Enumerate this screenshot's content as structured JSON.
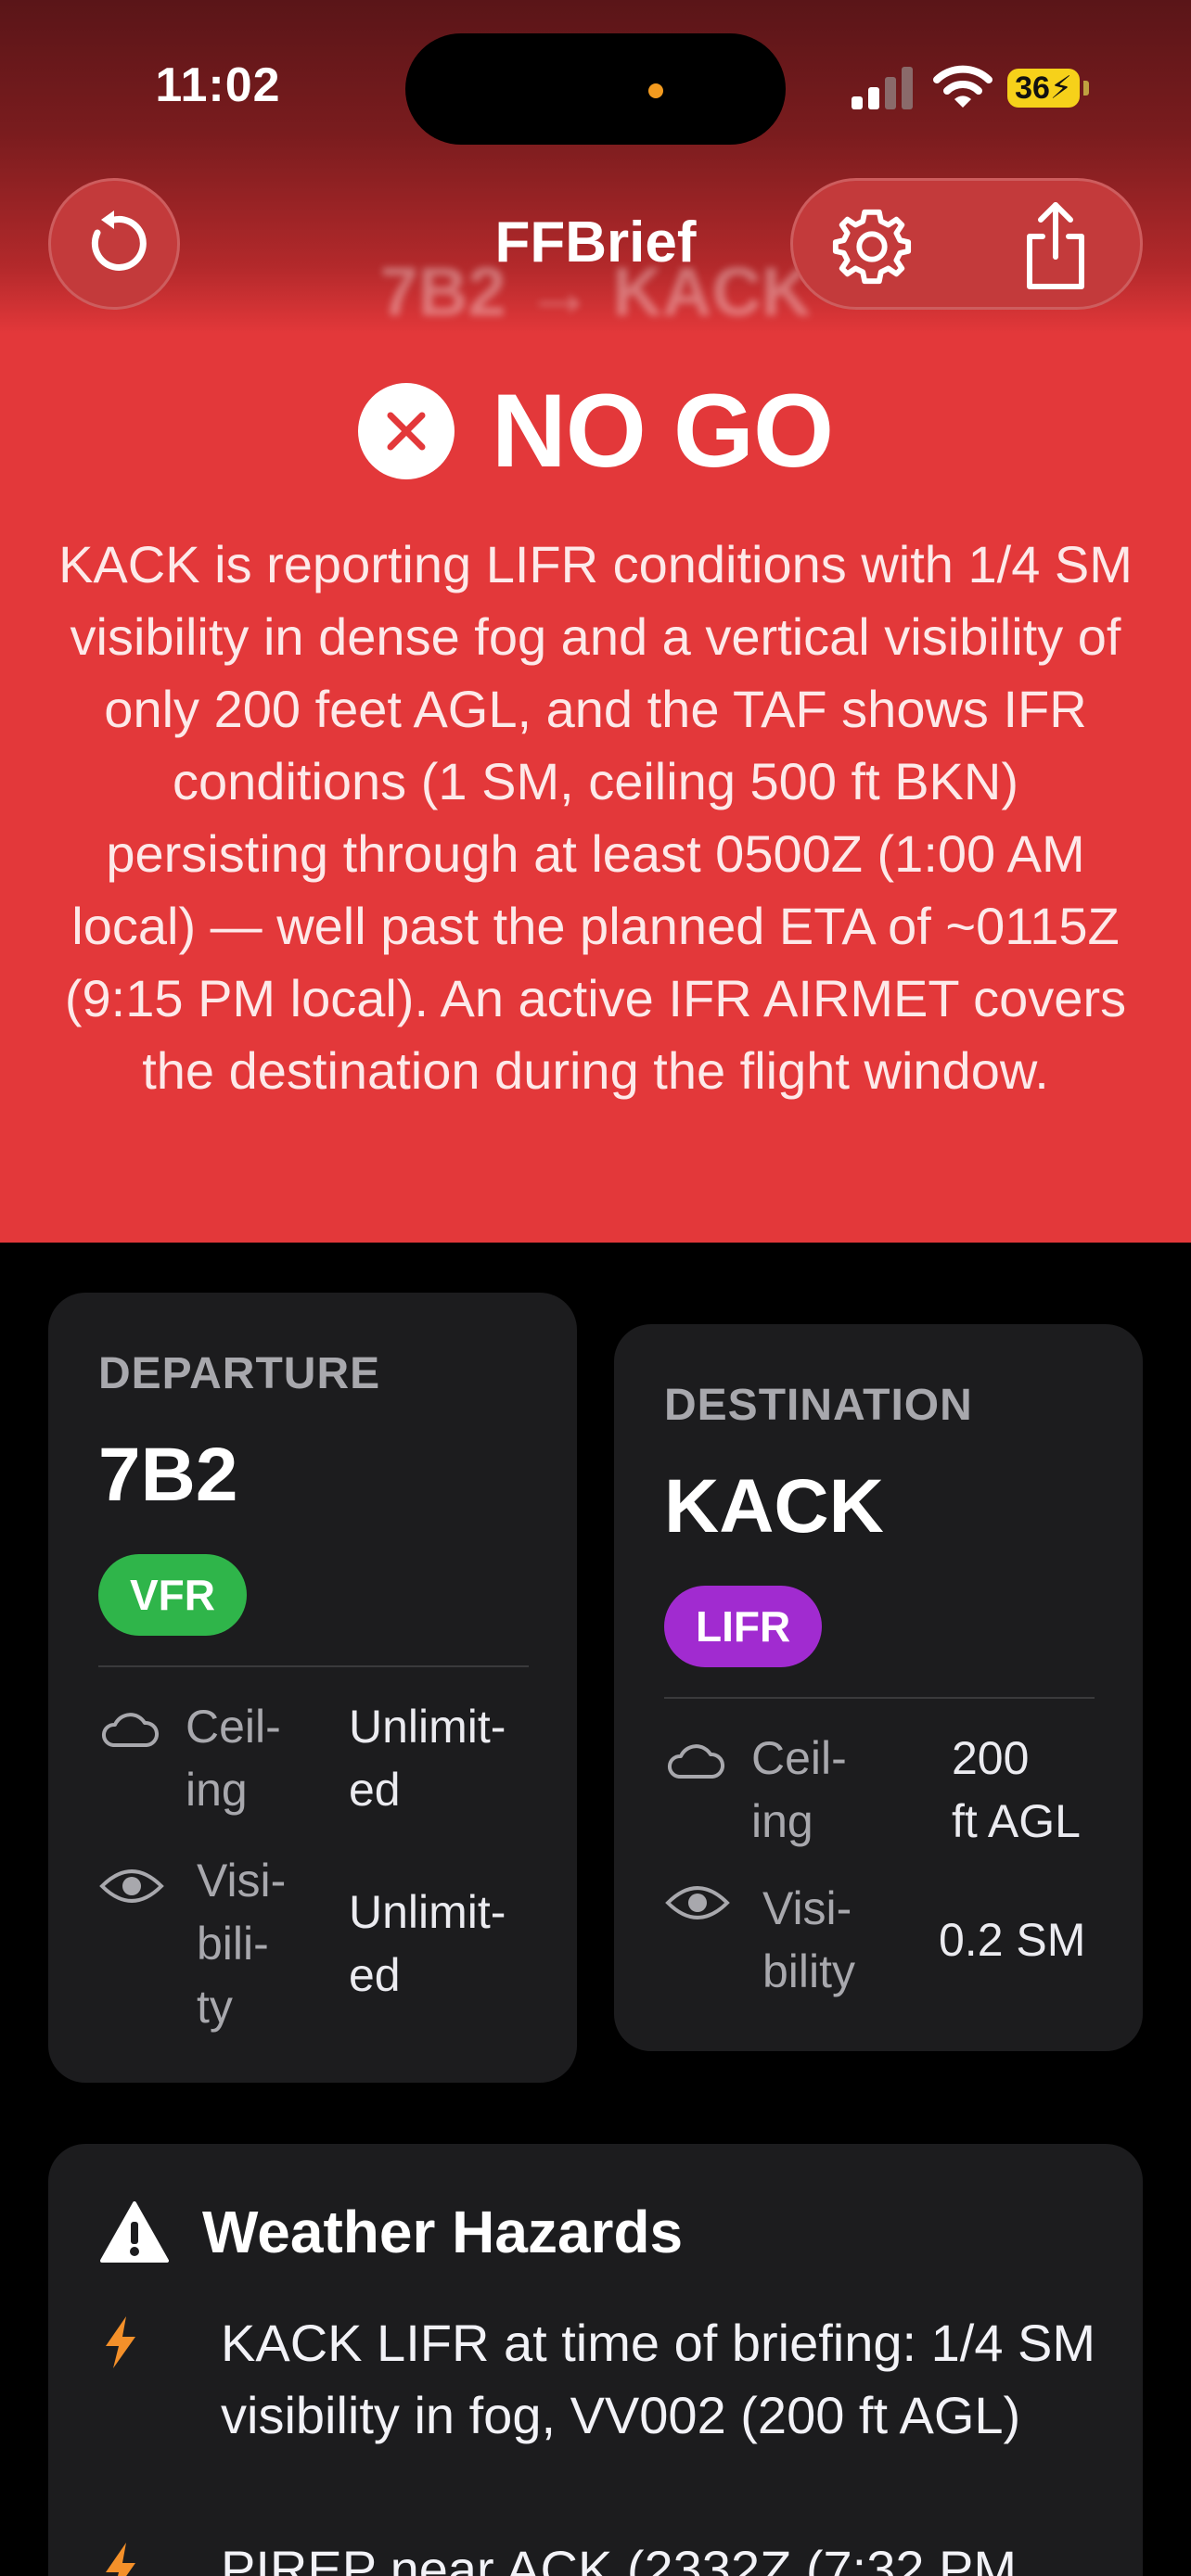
{
  "status_bar": {
    "time": "11:02",
    "battery": "36"
  },
  "nav": {
    "title": "FFBrief",
    "route": "7B2 → KACK",
    "icons": {
      "back": "rotate-ccw-icon",
      "settings": "gear-icon",
      "share": "share-icon"
    }
  },
  "verdict": {
    "label": "NO GO",
    "icon": "x-circle-icon",
    "summary": "KACK is reporting LIFR conditions with 1/4 SM visibility in dense fog and a vertical visibility of only 200 feet AGL, and the TAF shows IFR conditions (1 SM, ceiling 500 ft BKN) persisting through at least 0500Z (1:00 AM local) — well past the planned ETA of ~0115Z (9:15 PM local). An active IFR AIRMET covers the destination during the flight window.",
    "color": "#e3383a"
  },
  "departure": {
    "label": "DEPARTURE",
    "code": "7B2",
    "category": "VFR",
    "category_color": "#2fb54a",
    "ceiling_label": "Ceil-\ning",
    "ceiling_value": "Unlimit-\ned",
    "visibility_label": "Visi-\nbili-\nty",
    "visibility_value": "Unlimit-\ned"
  },
  "destination": {
    "label": "DESTINATION",
    "code": "KACK",
    "category": "LIFR",
    "category_color": "#a12bd0",
    "ceiling_label": "Ceil-\ning",
    "ceiling_value": "200\nft AGL",
    "visibility_label": "Visi-\nbility",
    "visibility_value": "0.2 SM"
  },
  "hazards": {
    "title": "Weather Hazards",
    "items": [
      "KACK LIFR at time of briefing: 1/4 SM visibility in fog, VV002 (200 ft AGL)",
      "PIREP near ACK (2332Z (7:32 PM"
    ]
  }
}
